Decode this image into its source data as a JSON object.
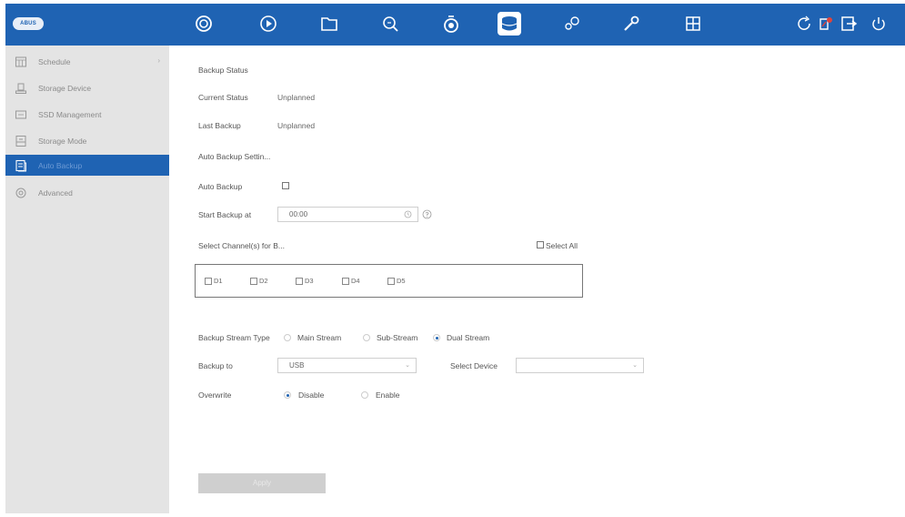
{
  "topbar": {
    "logo": "ABUS",
    "icons": [
      "camera-icon",
      "playback-icon",
      "file-icon",
      "search-icon",
      "alarm-icon",
      "storage-icon",
      "system-icon",
      "maintenance-icon",
      "layout-icon",
      "refresh-icon",
      "record-icon",
      "logout-icon",
      "power-icon"
    ],
    "active_icon": "storage-icon",
    "color": "#1f63b3"
  },
  "sidebar": {
    "items": [
      {
        "label": "Schedule",
        "icon": "calendar-icon",
        "has_arrow": true
      },
      {
        "label": "Storage Device",
        "icon": "storage-device-icon"
      },
      {
        "label": "SSD Management",
        "icon": "ssd-icon"
      },
      {
        "label": "Storage Mode",
        "icon": "storage-mode-icon"
      },
      {
        "label": "Auto Backup",
        "icon": "backup-icon",
        "active": true
      },
      {
        "label": "Advanced",
        "icon": "advanced-icon"
      }
    ],
    "arrow": "›"
  },
  "main": {
    "backup_status_heading": "Backup Status",
    "current_status_label": "Current Status",
    "current_status_value": "Unplanned",
    "last_backup_label": "Last Backup",
    "last_backup_value": "Unplanned",
    "auto_backup_settings_heading": "Auto Backup Settin...",
    "auto_backup_label": "Auto Backup",
    "start_backup_label": "Start Backup at",
    "start_backup_value": "00:00",
    "select_channels_label": "Select Channel(s) for B...",
    "select_all_label": "Select All",
    "channels": [
      "D1",
      "D2",
      "D3",
      "D4",
      "D5"
    ],
    "stream_type_label": "Backup Stream Type",
    "stream_options": [
      "Main Stream",
      "Sub-Stream",
      "Dual Stream"
    ],
    "stream_selected": "Dual Stream",
    "backup_to_label": "Backup to",
    "backup_to_value": "USB",
    "select_device_label": "Select Device",
    "select_device_value": "",
    "overwrite_label": "Overwrite",
    "overwrite_options": [
      "Disable",
      "Enable"
    ],
    "overwrite_selected": "Disable",
    "apply_label": "Apply"
  }
}
